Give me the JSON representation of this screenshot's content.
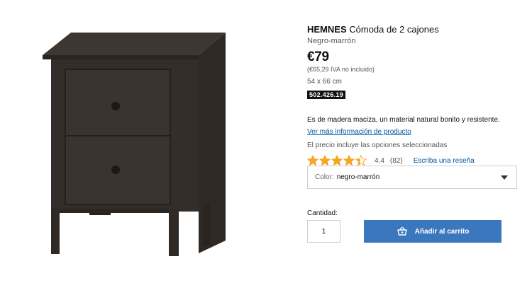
{
  "product": {
    "name": "HEMNES",
    "type": "Cómoda de 2 cajones",
    "color_name": "Negro-marrón",
    "price": "€79",
    "price_note": "(€65,29 IVA no incluido)",
    "dimensions": "54 x 66 cm",
    "article_number": "502.426.19",
    "description": "Es de madera maciza, un material natural bonito y resistente.",
    "more_info_link": "Ver más información de producto",
    "price_options_note": "El precio incluye las opciones seleccionadas"
  },
  "rating": {
    "value": "4.4",
    "count": "(82)",
    "stars_filled": 4.4,
    "stars_total": 5,
    "review_link": "Escriba una reseña",
    "star_color": "#f5a623"
  },
  "color_selector": {
    "label": "Color:",
    "selected": "negro-marrón"
  },
  "quantity": {
    "label": "Cantidad:",
    "value": "1"
  },
  "cart": {
    "button_label": "Añadir al carrito",
    "button_color": "#3b77bd",
    "icon": "cart-icon"
  }
}
